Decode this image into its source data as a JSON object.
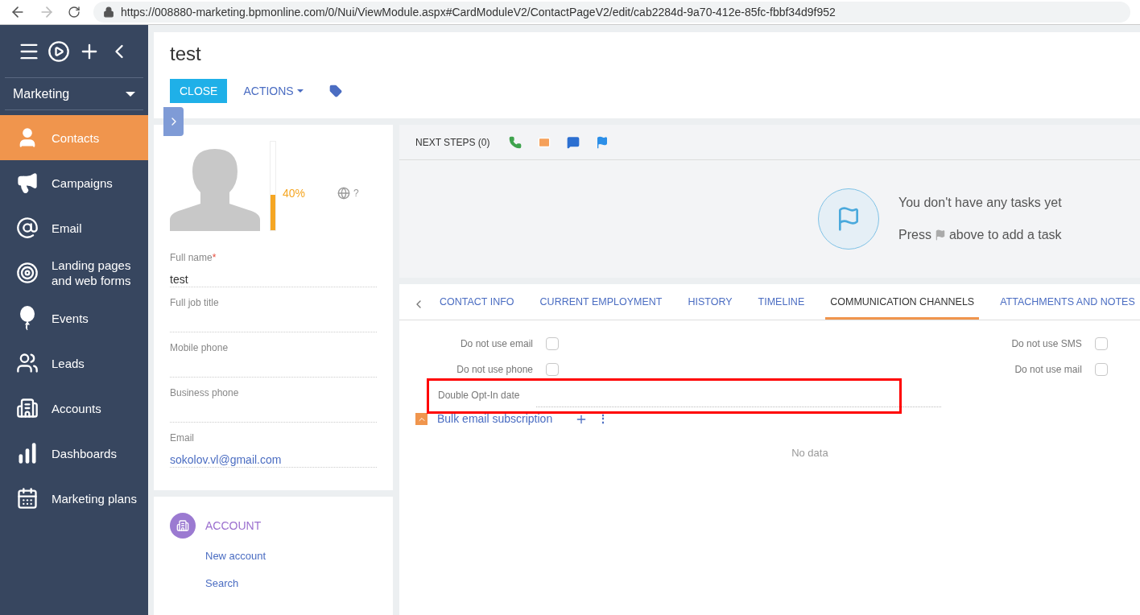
{
  "browser": {
    "url": "https://008880-marketing.bpmonline.com/0/Nui/ViewModule.aspx#CardModuleV2/ContactPageV2/edit/cab2284d-9a70-412e-85fc-fbbf34d9f952"
  },
  "sidebar": {
    "workplace": "Marketing",
    "items": [
      {
        "label": "Contacts",
        "kind": "contact",
        "selected": true
      },
      {
        "label": "Campaigns",
        "kind": "megaphone",
        "selected": false
      },
      {
        "label": "Email",
        "kind": "at",
        "selected": false
      },
      {
        "label": "Landing pages and web forms",
        "kind": "target",
        "selected": false
      },
      {
        "label": "Events",
        "kind": "balloon",
        "selected": false
      },
      {
        "label": "Leads",
        "kind": "leads",
        "selected": false
      },
      {
        "label": "Accounts",
        "kind": "building",
        "selected": false
      },
      {
        "label": "Dashboards",
        "kind": "chart",
        "selected": false
      },
      {
        "label": "Marketing plans",
        "kind": "calendar",
        "selected": false
      }
    ]
  },
  "page": {
    "title": "test",
    "close_button": "CLOSE",
    "actions_button": "ACTIONS"
  },
  "profile": {
    "completeness": {
      "level": 0.4,
      "reading": "40%"
    },
    "help": "?"
  },
  "fields": [
    {
      "label": "Full name",
      "required_mark": "*",
      "value": "test",
      "kind": "text"
    },
    {
      "label": "Full job title"
    },
    {
      "label": "Mobile phone"
    },
    {
      "label": "Business phone"
    },
    {
      "label": "Email",
      "value": "sokolov.vl@gmail.com",
      "kind": "link"
    }
  ],
  "account": {
    "title": "ACCOUNT",
    "links": [
      "New account",
      "Search"
    ]
  },
  "next_steps": {
    "tab": "NEXT STEPS (0)",
    "empty_title": "You don't have any tasks yet",
    "hint_before": "Press",
    "hint_after": "above to add a task"
  },
  "tabs": [
    {
      "label": "CONTACT INFO",
      "selected": false
    },
    {
      "label": "CURRENT EMPLOYMENT",
      "selected": false
    },
    {
      "label": "HISTORY",
      "selected": false
    },
    {
      "label": "TIMELINE",
      "selected": false
    },
    {
      "label": "COMMUNICATION CHANNELS",
      "selected": true
    },
    {
      "label": "ATTACHMENTS AND NOTES",
      "selected": false
    }
  ],
  "channels_left": [
    {
      "label": "Do not use email",
      "checked": false
    },
    {
      "label": "Do not use phone",
      "checked": false
    }
  ],
  "channels_right": [
    {
      "label": "Do not use SMS",
      "checked": false
    },
    {
      "label": "Do not use mail",
      "checked": false
    }
  ],
  "opt_in": {
    "label": "Double Opt-In date",
    "highlighted": true
  },
  "subscription": {
    "title": "Bulk email subscription",
    "expanded": true,
    "more": "⋮",
    "empty": "No data"
  }
}
